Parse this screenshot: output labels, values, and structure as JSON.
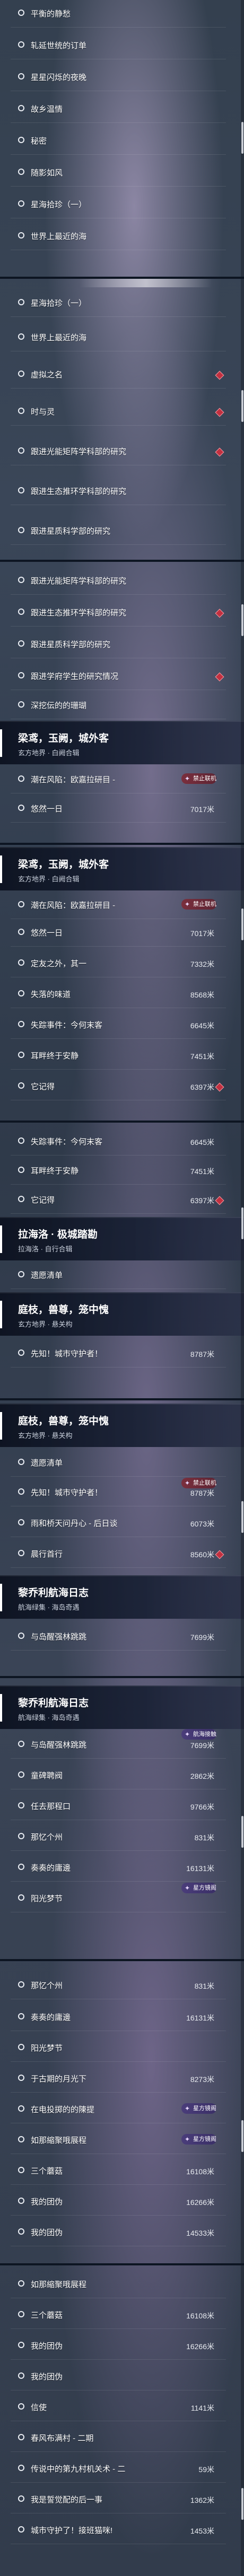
{
  "screens": [
    {
      "items": [
        {
          "label": "平衡的静愁"
        },
        {
          "label": "轧延世统的订单"
        },
        {
          "label": "星星闪烁的夜晚"
        },
        {
          "label": "故乡温情"
        },
        {
          "label": "秘密"
        },
        {
          "label": "随影如风"
        },
        {
          "label": "星海拾珍（一）"
        },
        {
          "label": "世界上最近的海"
        }
      ]
    },
    {
      "items": [
        {
          "label": "星海拾珍（一）"
        },
        {
          "label": "世界上最近的海"
        },
        {
          "label": "虚拟之名"
        },
        {
          "label": "时与灵"
        },
        {
          "label": "跟进光能矩阵学科部的研究"
        },
        {
          "label": "跟进生态推环学科部的研究"
        },
        {
          "label": "跟进星质科学部的研究"
        }
      ]
    },
    {
      "items": [
        {
          "label": "跟进光能矩阵学科部的研究"
        },
        {
          "label": "跟进生态推环学科部的研究"
        },
        {
          "label": "跟进星质科学部的研究"
        },
        {
          "label": "跟进学府学生的研究情况"
        },
        {
          "label": "深挖伝的的珊瑚"
        }
      ],
      "header": {
        "title": "梁鸢，玉阙，城外客",
        "sub": "玄方地界 · 白阙合辑"
      },
      "after_header": [
        {
          "label": "潮在风陷：欧嘉拉研目 -",
          "dist": ""
        },
        {
          "label": "悠然一日",
          "dist": "7017米"
        }
      ]
    },
    {
      "header": {
        "title": "梁鸢，玉阙，城外客",
        "sub": "玄方地界 · 白阙合辑"
      },
      "items": [
        {
          "label": "潮在风陷：欧嘉拉研目 -",
          "dist": "",
          "flag": "禁止联机"
        },
        {
          "label": "悠然一日",
          "dist": "7017米"
        },
        {
          "label": "定友之外，其一",
          "dist": "7332米"
        },
        {
          "label": "失落的味道",
          "dist": "8568米"
        },
        {
          "label": "失踪事件：今何末客",
          "dist": "6645米"
        },
        {
          "label": "耳畔终于安静",
          "dist": "7451米"
        },
        {
          "label": "它记得",
          "dist": "6397米"
        }
      ]
    },
    {
      "items": [
        {
          "label": "失踪事件：今何末客",
          "dist": "6645米",
          "flag": "禁止联机"
        },
        {
          "label": "耳畔终于安静",
          "dist": "7451米"
        },
        {
          "label": "它记得",
          "dist": "6397米"
        }
      ],
      "header": {
        "title": "拉海洛 · 极城踏勘",
        "sub": "拉海洛 · 自行合辑"
      },
      "after_header": [
        {
          "label": "遗愿清单",
          "dist": ""
        }
      ],
      "header2": {
        "title": "庭枝，兽尊，笼中愧",
        "sub": "玄方地界 · 悬关构"
      },
      "after_header2": [
        {
          "label": "先知！城市守护者！",
          "dist": "8787米"
        }
      ]
    },
    {
      "header": {
        "title": "庭枝，兽尊，笼中愧",
        "sub": "玄方地界 · 悬关构"
      },
      "items": [
        {
          "label": "遗愿清单",
          "dist": ""
        },
        {
          "label": "先知！城市守护者！",
          "dist": "8787米",
          "flag": "禁止联机"
        },
        {
          "label": "雨和桥天问丹心 - 后日谈",
          "dist": "6073米"
        },
        {
          "label": "晨行首行",
          "dist": "8560米"
        }
      ],
      "header2": {
        "title": "黎乔利航海日志",
        "sub": "航海绿集 · 海岛奇遇"
      },
      "after_header2": [
        {
          "label": "与岛醒强林跳跳",
          "dist": "7699米"
        }
      ]
    },
    {
      "header": {
        "title": "黎乔利航海日志",
        "sub": "航海绿集 · 海岛奇遇"
      },
      "items": [
        {
          "label": "与岛醒强林跳跳",
          "dist": "7699米",
          "flag": "航海接触"
        },
        {
          "label": "童碑聘阀",
          "dist": "2862米"
        },
        {
          "label": "任去那程口",
          "dist": "9766米"
        },
        {
          "label": "那忆个州",
          "dist": "831米"
        },
        {
          "label": "奏奏的庸邊",
          "dist": "16131米"
        },
        {
          "label": "阳光梦节",
          "dist": "",
          "flag": "星方镜阁"
        }
      ]
    },
    {
      "items": [
        {
          "label": "那忆个州",
          "dist": "831米"
        },
        {
          "label": "奏奏的庸邊",
          "dist": "16131米"
        },
        {
          "label": "阳光梦节",
          "dist": ""
        },
        {
          "label": "于古期的月光下",
          "dist": "8273米"
        },
        {
          "label": "在电投掷的的陳提",
          "dist": "",
          "flag": "星方镜阁"
        },
        {
          "label": "如那縮聚哦展程",
          "dist": "",
          "flag": "星方镜阁"
        },
        {
          "label": "三个蘑菇",
          "dist": "16108米"
        },
        {
          "label": "我的团伪",
          "dist": "16266米"
        },
        {
          "label": "我的团伪",
          "dist": "14533米"
        }
      ]
    },
    {
      "items": [
        {
          "label": "如那縮聚哦展程",
          "dist": ""
        },
        {
          "label": "三个蘑菇",
          "dist": "16108米"
        },
        {
          "label": "我的团伪",
          "dist": "16266米"
        },
        {
          "label": "我的团伪",
          "dist": ""
        },
        {
          "label": "信使",
          "dist": "1141米"
        },
        {
          "label": "春风布满村 - 二期",
          "dist": ""
        },
        {
          "label": "传说中的第九村机关术 - 二",
          "dist": "59米"
        },
        {
          "label": "我是誓觉配的后一事",
          "dist": "1362米"
        },
        {
          "label": "城市守护了！接班猫咪!",
          "dist": "1453米"
        }
      ]
    }
  ]
}
